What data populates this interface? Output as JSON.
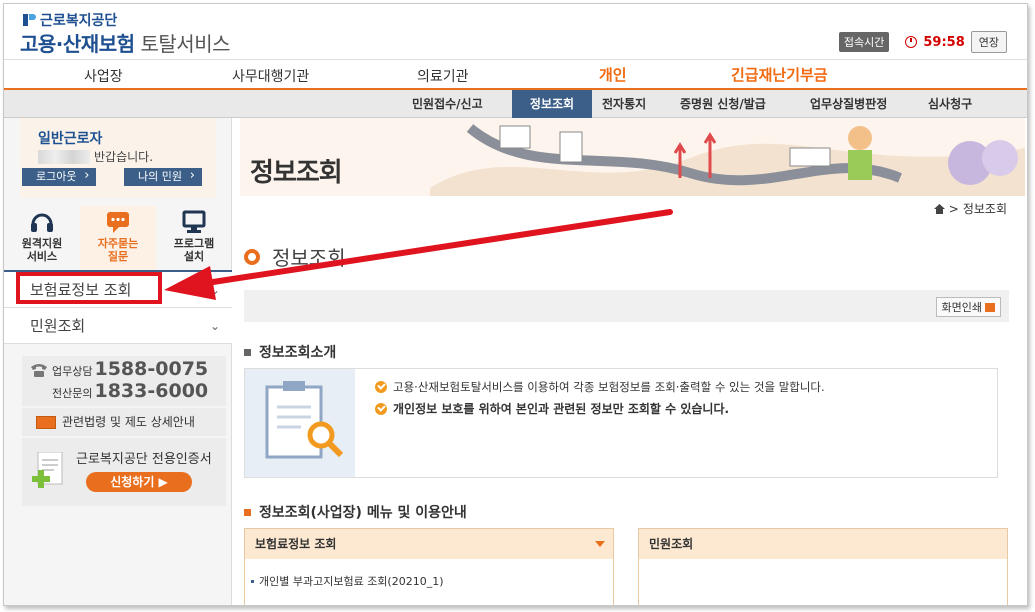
{
  "header": {
    "org_name": "근로복지공단",
    "service_name": "고용·산재보험",
    "service_sub": "토탈서비스",
    "session_label": "접속시간",
    "timer": "59:58",
    "extend_label": "연장"
  },
  "main_nav": {
    "items": [
      "사업장",
      "사무대행기관",
      "의료기관",
      "개인",
      "긴급재난기부금"
    ],
    "active": "개인"
  },
  "sub_nav": {
    "items": [
      "민원접수/신고",
      "정보조회",
      "전자통지",
      "증명원 신청/발급",
      "업무상질병판정",
      "심사청구"
    ],
    "active": "정보조회"
  },
  "sidebar": {
    "user_type": "일반근로자",
    "greeting": "반갑습니다.",
    "logout_label": "로그아웃",
    "my_petition_label": "나의 민원",
    "quick_links": [
      {
        "icon": "headset-icon",
        "label_line1": "원격지원",
        "label_line2": "서비스"
      },
      {
        "icon": "chat-icon",
        "label_line1": "자주묻는",
        "label_line2": "질문"
      },
      {
        "icon": "monitor-icon",
        "label_line1": "프로그램",
        "label_line2": "설치"
      }
    ],
    "menu": [
      {
        "label": "보험료정보 조회"
      },
      {
        "label": "민원조회"
      }
    ],
    "contact": {
      "business_label": "업무상담",
      "business_number": "1588-0075",
      "it_label": "전산문의",
      "it_number": "1833-6000"
    },
    "law_label": "관련법령 및 제도 상세안내",
    "cert": {
      "title": "근로복지공단 전용인증서",
      "button_label": "신청하기"
    }
  },
  "content": {
    "banner_title": "정보조회",
    "breadcrumb": "정보조회",
    "page_title": "정보조회",
    "print_label": "화면인쇄",
    "intro_section_title": "정보조회소개",
    "intro_lines": [
      "고용·산재보험토탈서비스를 이용하여 각종 보험정보를 조회·출력할 수 있는 것을 말합니다.",
      "개인정보 보호를 위하여 본인과 관련된 정보만 조회할 수 있습니다."
    ],
    "guide_section_title": "정보조회(사업장) 메뉴 및 이용안내",
    "panels": [
      {
        "title": "보험료정보 조회",
        "links": [
          "개인별 부과고지보험료 조회(20210_1)"
        ]
      },
      {
        "title": "민원조회",
        "links": []
      }
    ]
  },
  "colors": {
    "brand_blue": "#1d4f91",
    "accent_orange": "#e96f1f",
    "annotation_red": "#e0141e",
    "active_tab": "#3b5f88"
  }
}
